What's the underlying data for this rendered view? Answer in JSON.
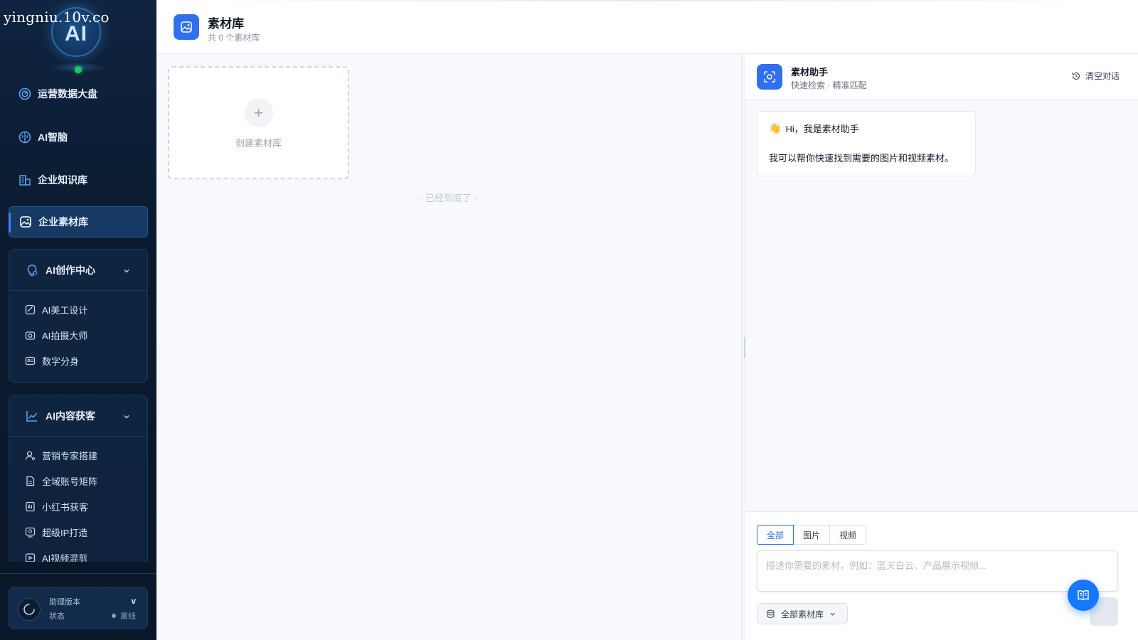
{
  "watermark": "yingniu.10v.co",
  "logo": {
    "text": "AI"
  },
  "nav": [
    {
      "label": "运营数据大盘",
      "icon": "dashboard-icon"
    },
    {
      "label": "AI智脑",
      "icon": "brain-icon"
    },
    {
      "label": "企业知识库",
      "icon": "building-icon"
    },
    {
      "label": "企业素材库",
      "icon": "image-icon",
      "active": true
    }
  ],
  "groups": [
    {
      "title": "AI创作中心",
      "icon": "lightbulb-icon",
      "items": [
        {
          "label": "AI美工设计",
          "icon": "design-icon"
        },
        {
          "label": "AI拍摄大师",
          "icon": "camera-icon"
        },
        {
          "label": "数字分身",
          "icon": "id-card-icon"
        }
      ]
    },
    {
      "title": "AI内容获客",
      "icon": "trend-icon",
      "items": [
        {
          "label": "营销专家搭建",
          "icon": "user-gear-icon"
        },
        {
          "label": "全域账号矩阵",
          "icon": "document-icon"
        },
        {
          "label": "小红书获客",
          "icon": "ai-doc-icon"
        },
        {
          "label": "超级IP打造",
          "icon": "ip-icon"
        },
        {
          "label": "AI视频混剪",
          "icon": "video-edit-icon"
        }
      ]
    }
  ],
  "status": {
    "version_label": "助理版本",
    "version_value": "v",
    "state_label": "状态",
    "state_value": "离线"
  },
  "header": {
    "title": "素材库",
    "subtitle": "共 0 个素材库"
  },
  "content": {
    "create_label": "创建素材库",
    "plus": "+",
    "end_hint": "- 已经到底了 -"
  },
  "assistant": {
    "title": "素材助手",
    "subtitle": "快速检索 · 精准匹配",
    "clear_label": "清空对话",
    "greeting_emoji": "👋",
    "greeting": "Hi，我是素材助手",
    "message": "我可以帮你快速找到需要的图片和视频素材。",
    "tabs": [
      "全部",
      "图片",
      "视频"
    ],
    "active_tab": 0,
    "input_placeholder": "描述你需要的素材，例如：蓝天白云、产品展示视频...",
    "input_value": "",
    "library_select": "全部素材库"
  },
  "colors": {
    "accent": "#2f6ff0",
    "sidebar_bg": "#0b1a2e",
    "online_dot": "#22c55e"
  }
}
